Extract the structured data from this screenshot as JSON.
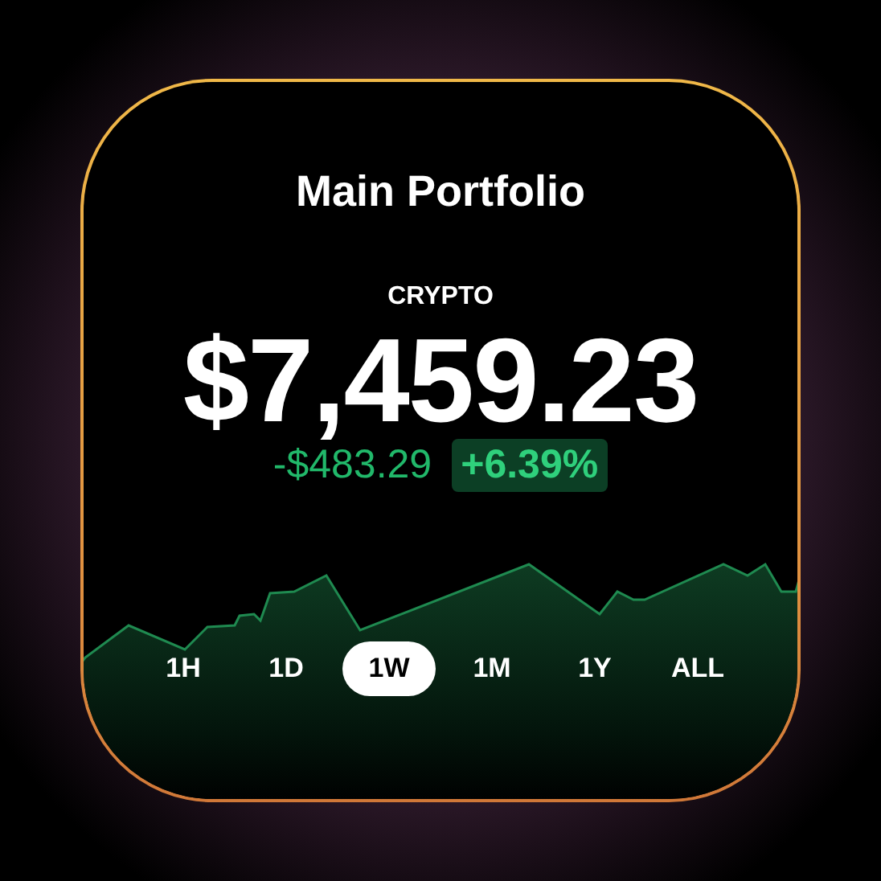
{
  "title": "Main Portfolio",
  "category": "CRYPTO",
  "balance": "$7,459.23",
  "change": {
    "amount": "-$483.29",
    "percent": "+6.39%"
  },
  "ranges": [
    {
      "label": "1H",
      "selected": false
    },
    {
      "label": "1D",
      "selected": false
    },
    {
      "label": "1W",
      "selected": true
    },
    {
      "label": "1M",
      "selected": false
    },
    {
      "label": "1Y",
      "selected": false
    },
    {
      "label": "ALL",
      "selected": false
    }
  ]
}
